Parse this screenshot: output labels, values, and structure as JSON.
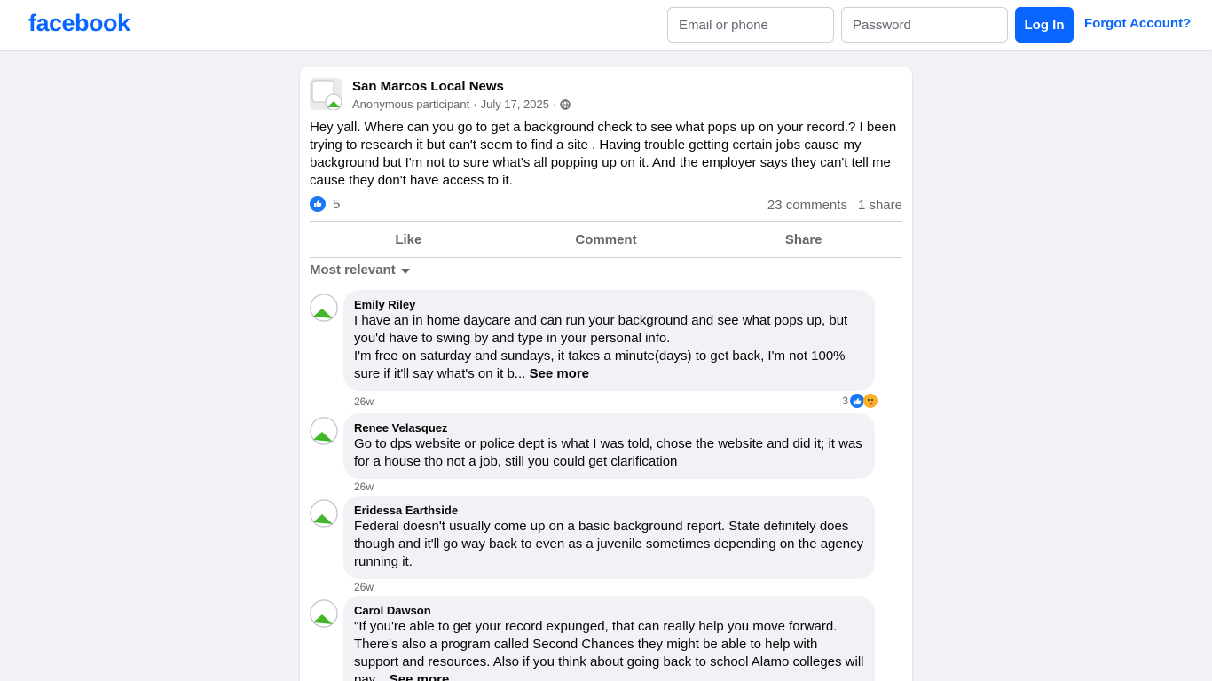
{
  "header": {
    "logo": "facebook",
    "email_placeholder": "Email or phone",
    "password_placeholder": "Password",
    "login_label": "Log In",
    "forgot_label": "Forgot Account?"
  },
  "post": {
    "group_name": "San Marcos Local News",
    "author": "Anonymous participant",
    "date": "July 17, 2025",
    "separator": "·",
    "text": "Hey yall. Where can you go to get a background check to see what pops up on your record.? I been trying to research it but can't seem to find a site . Having trouble getting certain jobs cause my background but I'm not to sure what's all popping up on it. And the employer says they can't tell me cause they don't have access to it.",
    "reaction_count": "5",
    "comments_count": "23 comments",
    "shares_count": "1 share"
  },
  "actions": {
    "like": "Like",
    "comment": "Comment",
    "share": "Share"
  },
  "sort_label": "Most relevant",
  "see_more_label": "See more",
  "comments": [
    {
      "name": "Emily Riley",
      "text": "I have an in home daycare and can run your background and see what pops up, but you'd have to swing by and type in your personal info.",
      "text2": "I'm free on saturday and sundays, it takes a minute(days) to get back, I'm not 100% sure if it'll say what's on it b...",
      "time": "26w",
      "reactions": "3"
    },
    {
      "name": "Renee Velasquez",
      "text": "Go to dps website or police dept is what I was told, chose the website and did it; it was for a house tho not a job, still you could get clarification",
      "time": "26w"
    },
    {
      "name": "Eridessa Earthside",
      "text": "Federal doesn't usually come up on a basic background report. State definitely does though and it'll go way back to even as a juvenile sometimes depending on the agency running it.",
      "time": "26w"
    },
    {
      "name": "Carol Dawson",
      "text": "\"If you're able to get your record expunged, that can really help you move forward. There's also a program called Second Chances they might be able to help with support and resources. Also if you think about going back to school Alamo colleges will pay..."
    }
  ],
  "colors": {
    "brand": "#0866ff",
    "background": "#f0f2f5",
    "bubble": "#f0f2f5",
    "secondary_text": "#65676b"
  }
}
